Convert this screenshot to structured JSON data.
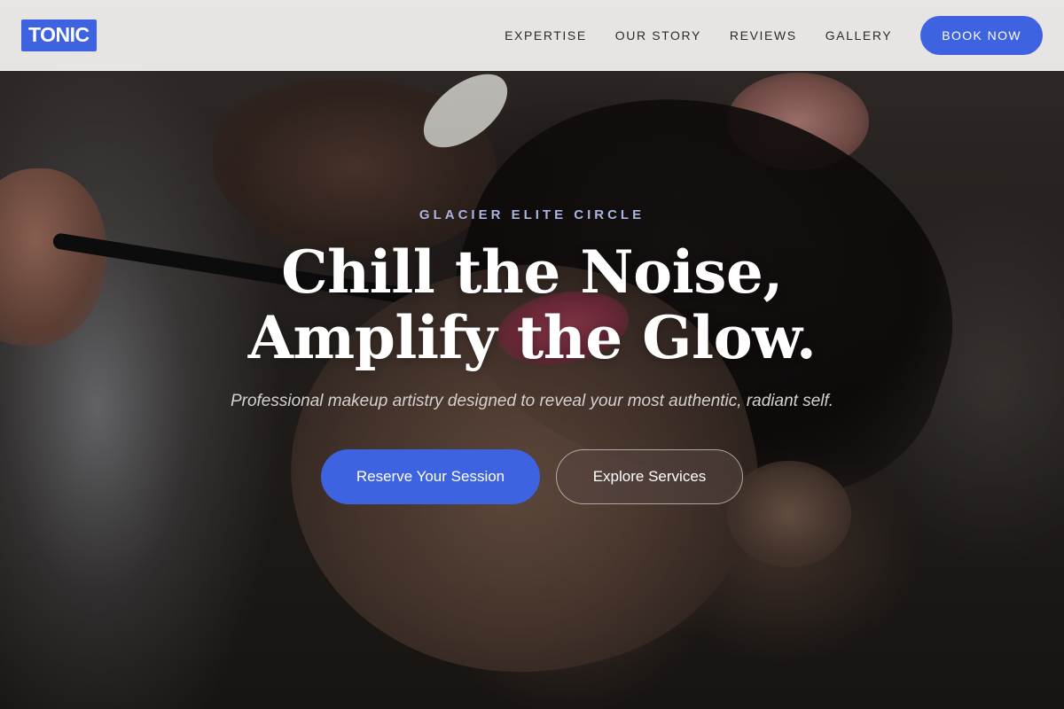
{
  "header": {
    "logo": "TONIC",
    "nav": [
      {
        "label": "EXPERTISE"
      },
      {
        "label": "OUR STORY"
      },
      {
        "label": "REVIEWS"
      },
      {
        "label": "GALLERY"
      }
    ],
    "book_button": "BOOK NOW"
  },
  "hero": {
    "eyebrow": "GLACIER ELITE CIRCLE",
    "headline_line1": "Chill the Noise,",
    "headline_line2": "Amplify the Glow.",
    "tagline": "Professional makeup artistry designed to reveal your most authentic, radiant self.",
    "primary_cta": "Reserve Your Session",
    "secondary_cta": "Explore Services",
    "background_image": "makeup-artist-applying-eyeshadow-photo"
  },
  "colors": {
    "accent": "#3d63e0",
    "header_bg": "#f3f1f0",
    "eyebrow": "#a9b4e0"
  }
}
